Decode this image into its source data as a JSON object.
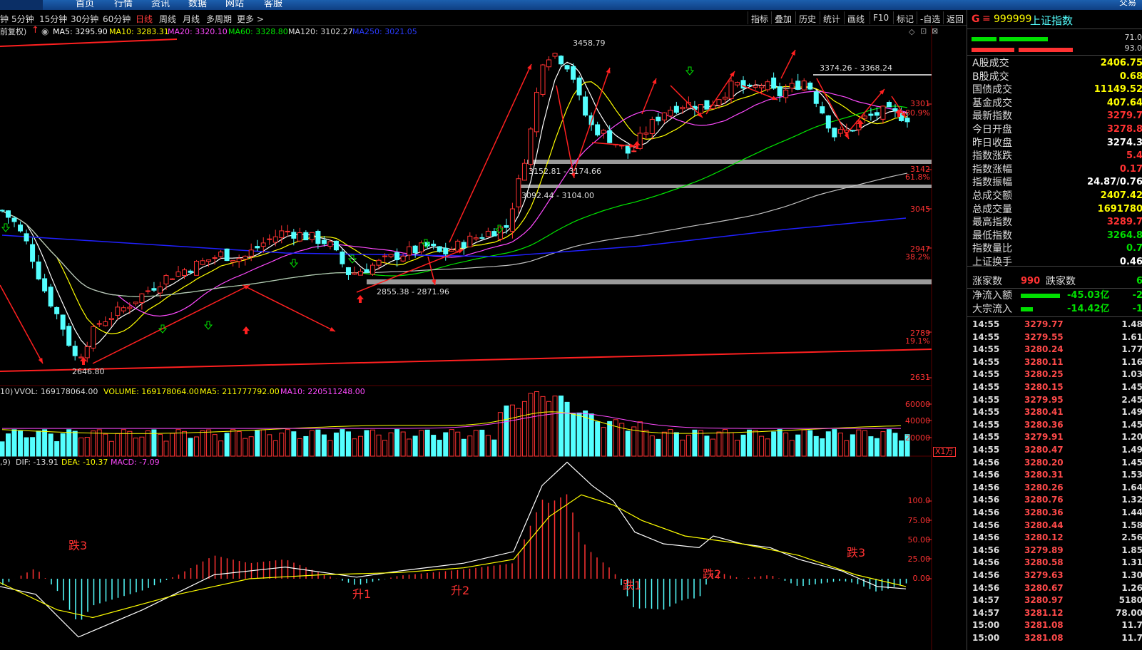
{
  "topnav": {
    "items": [
      "首页",
      "行情",
      "资讯",
      "数据",
      "网站",
      "客服"
    ],
    "right": "交易"
  },
  "period_tabs": [
    "钟",
    "5分钟",
    "15分钟",
    "30分钟",
    "60分钟",
    "日线",
    "周线",
    "月线",
    "多周期",
    "更多 >"
  ],
  "active_period": "日线",
  "tools": [
    "指标",
    "叠加",
    "历史",
    "统计",
    "画线",
    "F10",
    "标记",
    "-自选",
    "返回"
  ],
  "ma_legend": {
    "mode": "前复权)",
    "ma5": "MA5: 3295.90",
    "ma10": "MA10: 3283.31",
    "ma20": "MA20: 3320.10",
    "ma60": "MA60: 3328.80",
    "ma120": "MA120: 3102.27",
    "ma250": "MA250: 3021.05"
  },
  "price_axis": {
    "ticks": [
      "3301",
      "3142",
      "3045",
      "2947",
      "2789",
      "2631"
    ],
    "pcts": [
      "80.9%",
      "61.8%",
      "38.2%",
      "19.1%"
    ]
  },
  "annotations": {
    "high": "3458.79",
    "low": "2646.80",
    "zone1": "3374.26 - 3368.24",
    "zone2": "3152.81 - 3174.66",
    "zone3": "3092.44 - 3104.00",
    "zone4": "2855.38 - 2871.96"
  },
  "volume": {
    "label": "VOL",
    "vol": "VVOL: 169178064.00",
    "volume": "VOLUME: 169178064.00",
    "ma5": "MA5: 211777792.00",
    "ma10": "MA10: 220511248.00",
    "ticks": [
      "60000",
      "40000",
      "20000"
    ],
    "unit": "X1万",
    "tag": "10)"
  },
  "macd": {
    "tag": ",9)",
    "dif": "DIF: -13.91",
    "dea": "DEA: -10.37",
    "macd": "MACD: -7.09",
    "ticks": [
      "100.0",
      "75.00",
      "50.00",
      "25.00",
      "0.00"
    ],
    "labels": [
      "跌3",
      "升1",
      "升2",
      "跌1",
      "跌2",
      "跌3"
    ]
  },
  "quote": {
    "marker": "G",
    "code": "999999",
    "name": "上证指数",
    "bar1": "71.0",
    "bar2": "93.0"
  },
  "stats": [
    {
      "k": "A股成交",
      "v": "2406.75"
    },
    {
      "k": "B股成交",
      "v": "0.68"
    },
    {
      "k": "国债成交",
      "v": "11149.52"
    },
    {
      "k": "基金成交",
      "v": "407.64"
    },
    {
      "k": "最新指数",
      "v": "3279.7"
    },
    {
      "k": "今日开盘",
      "v": "3278.8"
    },
    {
      "k": "昨日收盘",
      "v": "3274.3"
    },
    {
      "k": "指数涨跌",
      "v": "5.4"
    },
    {
      "k": "指数涨幅",
      "v": "0.17"
    },
    {
      "k": "指数振幅",
      "v": "24.87/0.76"
    },
    {
      "k": "总成交额",
      "v": "2407.42"
    },
    {
      "k": "总成交量",
      "v": "1691780"
    },
    {
      "k": "最高指数",
      "v": "3289.7"
    },
    {
      "k": "最低指数",
      "v": "3264.8"
    },
    {
      "k": "指数量比",
      "v": "0.7"
    },
    {
      "k": "上证换手",
      "v": "0.46"
    }
  ],
  "updown": {
    "up_label": "涨家数",
    "up": "990",
    "down_label": "跌家数",
    "down": "6"
  },
  "flows": [
    {
      "k": "净流入额",
      "v": "-45.03亿",
      "v2": "-2"
    },
    {
      "k": "大宗流入",
      "v": "-14.42亿",
      "v2": "-1"
    }
  ],
  "ticks": [
    {
      "t": "14:55",
      "p": "3279.77",
      "v": "1.48"
    },
    {
      "t": "14:55",
      "p": "3279.55",
      "v": "1.61"
    },
    {
      "t": "14:55",
      "p": "3280.24",
      "v": "1.77"
    },
    {
      "t": "14:55",
      "p": "3280.11",
      "v": "1.16"
    },
    {
      "t": "14:55",
      "p": "3280.25",
      "v": "1.03"
    },
    {
      "t": "14:55",
      "p": "3280.15",
      "v": "1.45"
    },
    {
      "t": "14:55",
      "p": "3279.95",
      "v": "2.45"
    },
    {
      "t": "14:55",
      "p": "3280.41",
      "v": "1.49"
    },
    {
      "t": "14:55",
      "p": "3280.36",
      "v": "1.45"
    },
    {
      "t": "14:55",
      "p": "3279.91",
      "v": "1.20"
    },
    {
      "t": "14:55",
      "p": "3280.47",
      "v": "1.49"
    },
    {
      "t": "14:56",
      "p": "3280.20",
      "v": "1.45"
    },
    {
      "t": "14:56",
      "p": "3280.31",
      "v": "1.53"
    },
    {
      "t": "14:56",
      "p": "3280.26",
      "v": "1.64"
    },
    {
      "t": "14:56",
      "p": "3280.76",
      "v": "1.32"
    },
    {
      "t": "14:56",
      "p": "3280.36",
      "v": "1.44"
    },
    {
      "t": "14:56",
      "p": "3280.44",
      "v": "1.58"
    },
    {
      "t": "14:56",
      "p": "3280.12",
      "v": "2.56"
    },
    {
      "t": "14:56",
      "p": "3279.89",
      "v": "1.85"
    },
    {
      "t": "14:56",
      "p": "3280.58",
      "v": "1.31"
    },
    {
      "t": "14:56",
      "p": "3279.63",
      "v": "1.30"
    },
    {
      "t": "14:56",
      "p": "3280.67",
      "v": "1.26"
    },
    {
      "t": "14:57",
      "p": "3280.97",
      "v": "5180"
    },
    {
      "t": "14:57",
      "p": "3281.12",
      "v": "78.00"
    },
    {
      "t": "15:00",
      "p": "3281.08",
      "v": "11.7"
    },
    {
      "t": "15:00",
      "p": "3281.08",
      "v": "11.7"
    }
  ],
  "colors": {
    "up": "#ff3232",
    "down": "#54ffff",
    "ma5": "#ffffff",
    "ma10": "#ffff00",
    "ma20": "#ff4aff",
    "ma60": "#00e600",
    "ma120": "#c0c0c0",
    "ma250": "#2020ff",
    "grid": "#5a0000"
  }
}
